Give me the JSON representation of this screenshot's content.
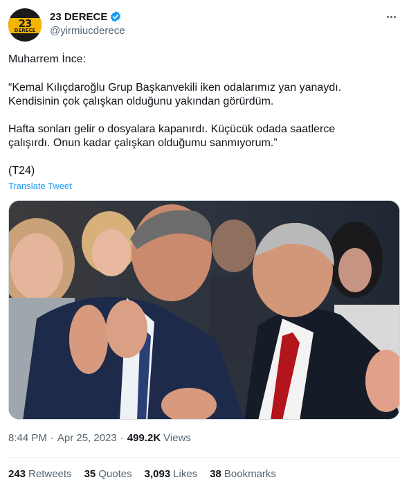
{
  "account": {
    "display_name": "23 DERECE",
    "handle": "@yirmiucderece",
    "avatar_number": "23",
    "avatar_word": "DERECE",
    "verified": true,
    "verified_color": "#1d9bf0"
  },
  "tweet": {
    "lines": [
      "Muharrem İnce:",
      "“Kemal Kılıçdaroğlu Grup Başkanvekili iken odalarımız yan yanaydı.",
      "Kendisinin çok çalışkan olduğunu yakından görürdüm.",
      "Hafta sonları gelir o dosyalara kapanırdı. Küçücük odada saatlerce",
      "çalışırdı. Onun kadar çalışkan olduğumu sanmıyorum.”",
      "(T24)"
    ],
    "translate_label": "Translate Tweet",
    "time": "8:44 PM",
    "date": "Apr 25, 2023",
    "separator": "·",
    "views_count": "499.2K",
    "views_label": "Views"
  },
  "stats": [
    {
      "count": "243",
      "label": "Retweets"
    },
    {
      "count": "35",
      "label": "Quotes"
    },
    {
      "count": "3,093",
      "label": "Likes"
    },
    {
      "count": "38",
      "label": "Bookmarks"
    }
  ],
  "icons": {
    "more": "more-icon",
    "verified": "verified-badge-icon"
  },
  "colors": {
    "link": "#1d9bf0",
    "secondary_text": "#536471",
    "avatar_accent": "#f5b400"
  }
}
